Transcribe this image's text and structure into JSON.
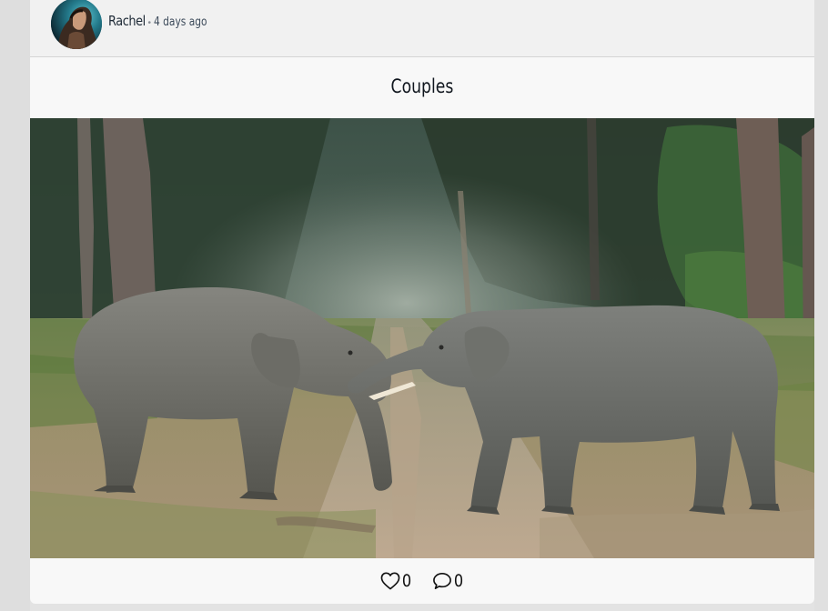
{
  "post": {
    "author": "Rachel",
    "separator": "•",
    "time_ago": "4 days ago",
    "title": "Couples",
    "image_alt": "Two elephants meeting on a forest path"
  },
  "actions": {
    "likes": "0",
    "comments": "0"
  },
  "icons": {
    "like": "heart-icon",
    "comment": "speech-bubble-icon"
  },
  "colors": {
    "header_bg": "#f1f1f1",
    "card_bg": "#f8f8f8",
    "page_bg": "#e3e3e3",
    "text": "#10161e"
  }
}
